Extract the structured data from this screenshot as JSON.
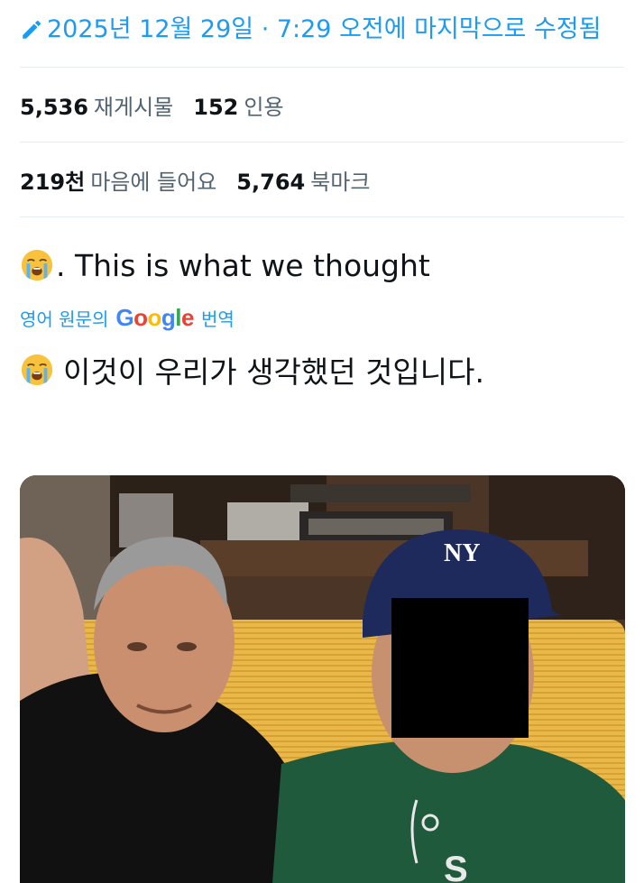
{
  "edited": {
    "icon": "pencil-icon",
    "text": "2025년 12월 29일 · 7:29 오전에 마지막으로 수정됨"
  },
  "stats": {
    "reposts_count": "5,536",
    "reposts_label": "재게시물",
    "quotes_count": "152",
    "quotes_label": "인용",
    "likes_count": "219천",
    "likes_label": "마음에 들어요",
    "bookmarks_count": "5,764",
    "bookmarks_label": "북마크"
  },
  "tweet": {
    "emoji": "loudly-crying-face-icon",
    "text": ". This is what we thought"
  },
  "translation": {
    "prefix": "영어 원문의",
    "google": "Google",
    "suffix": "번역",
    "text": "이것이 우리가 생각했던 것입니다."
  },
  "photo": {
    "cap_logo": "NY"
  },
  "colors": {
    "link": "#1d9bf0",
    "text": "#0f1419",
    "muted": "#536471"
  }
}
